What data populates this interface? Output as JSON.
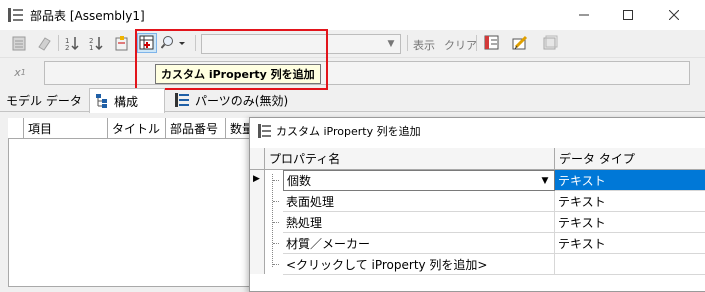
{
  "window": {
    "title": "部品表 [Assembly1]"
  },
  "toolbar": {
    "filter_label": "表示",
    "clear_label": "クリア",
    "combo_value": ""
  },
  "tooltip": {
    "text": "カスタム iProperty 列を追加"
  },
  "tabs": [
    {
      "label": "モデル データ"
    },
    {
      "label": "構成"
    },
    {
      "label": "パーツのみ(無効)"
    }
  ],
  "bom_table": {
    "columns": [
      "項目",
      "タイトル",
      "部品番号",
      "数量"
    ]
  },
  "dialog": {
    "title": "カスタム iProperty 列を追加",
    "columns": [
      "プロパティ名",
      "データ タイプ"
    ],
    "rows": [
      {
        "name": "個数",
        "type": "テキスト",
        "selected": true
      },
      {
        "name": "表面処理",
        "type": "テキスト",
        "selected": false
      },
      {
        "name": "熱処理",
        "type": "テキスト",
        "selected": false
      },
      {
        "name": "材質／メーカー",
        "type": "テキスト",
        "selected": false
      },
      {
        "name": "<クリックして iProperty 列を追加>",
        "type": "",
        "selected": false
      }
    ]
  },
  "colors": {
    "highlight": "#0078d7",
    "callout": "#e2141b",
    "tooltip_bg": "#ffffe1"
  }
}
